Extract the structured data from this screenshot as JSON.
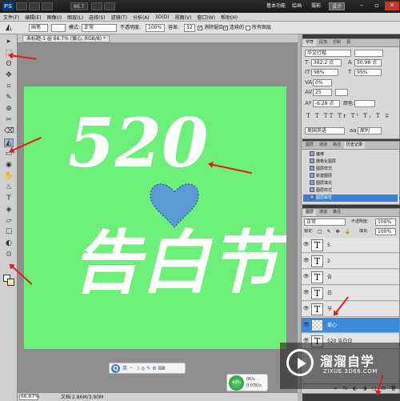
{
  "titlebar": {
    "logo": "PS",
    "mini_buttons": [
      "",
      "66.7",
      "",
      ""
    ],
    "workspaces": [
      "基本功能",
      "绘画",
      "摄影",
      "设计"
    ],
    "active_workspace": "设计"
  },
  "menu": [
    "文件(F)",
    "编辑(E)",
    "图像(I)",
    "图层(L)",
    "选择(S)",
    "滤镜(T)",
    "分析(A)",
    "3D(D)",
    "视图(V)",
    "窗口(W)",
    "帮助(H)"
  ],
  "options": {
    "brush_preset": "画笔",
    "mode_label": "模式:",
    "mode_value": "正常",
    "opacity_label": "不透明度:",
    "opacity_value": "100%",
    "tolerance_label": "容差:",
    "tolerance_value": "32",
    "antialias": "消除锯齿",
    "contiguous": "连续的",
    "all_layers": "所有图层"
  },
  "document": {
    "tab_label": "未标题-1 @ 66.7% (爱心, RGB/8) *",
    "zoom": "66.67%",
    "doc_size": "文档:2.86M/3.90M",
    "canvas_color": "#6df07a",
    "artwork": {
      "line1": "520",
      "line2": "告白节",
      "heart_color": "#5b9ad5"
    }
  },
  "ime": {
    "logo": "Q",
    "items": "英 ・ ☽ ◎ ✎ ⚙ ⌨"
  },
  "net": {
    "percent": "42%",
    "up": "0K/s",
    "down": "0.07K/s"
  },
  "watermark": {
    "title": "溜溜自学",
    "subtitle": "ZIXUE.3D66.COM"
  },
  "character_panel": {
    "tabs": [
      "字符",
      "段落",
      "仿制",
      "源"
    ],
    "font_family": "华文行楷",
    "font_size": "382.2 点",
    "leading": "50.98 点",
    "vertical_scale": "98%",
    "horizontal_scale": "95%",
    "tracking": "0%",
    "kerning": "25",
    "baseline_shift": "-6.28 点",
    "color_label": "颜色:",
    "language": "美国英语",
    "antialias": "犀利"
  },
  "history_panel": {
    "tabs": [
      "图层",
      "通道",
      "路径",
      "历史记录"
    ],
    "items": [
      "魔棒",
      "栅格化图层",
      "图层样式",
      "新建图层",
      "图层填充",
      "图层样式",
      "图层属性"
    ],
    "selected_index": 6
  },
  "layers_panel": {
    "tabs": [
      "图层",
      "通道",
      "路径"
    ],
    "blend_mode": "正常",
    "opacity_label": "不透明度:",
    "opacity": "100%",
    "lock_label": "锁定:",
    "fill_label": "填充:",
    "fill": "100%",
    "layers": [
      {
        "thumb": "T",
        "name": "5"
      },
      {
        "thumb": "T",
        "name": "2"
      },
      {
        "thumb": "T",
        "name": "告"
      },
      {
        "thumb": "T",
        "name": "白"
      },
      {
        "thumb": "T",
        "name": "节"
      },
      {
        "thumb": "",
        "name": "爱心",
        "selected": true
      },
      {
        "thumb": "T",
        "name": "520    告白日"
      }
    ],
    "bottom_icons": [
      "∞",
      "fx",
      "◐",
      "◑",
      "▢",
      "⊡",
      "🗑"
    ]
  },
  "tools": [
    "▸",
    "⬚",
    "ʘ",
    "✥",
    "⌗",
    "✎",
    "⊕",
    "✂",
    "⌫",
    "◭",
    "▭",
    "◉",
    "✋",
    "♨",
    "T",
    "◈",
    "▱",
    "☐",
    "◐",
    "⊙"
  ],
  "colors": {
    "annotation_arrow": "#e21b1b",
    "selected_layer": "#3b8ad9"
  }
}
